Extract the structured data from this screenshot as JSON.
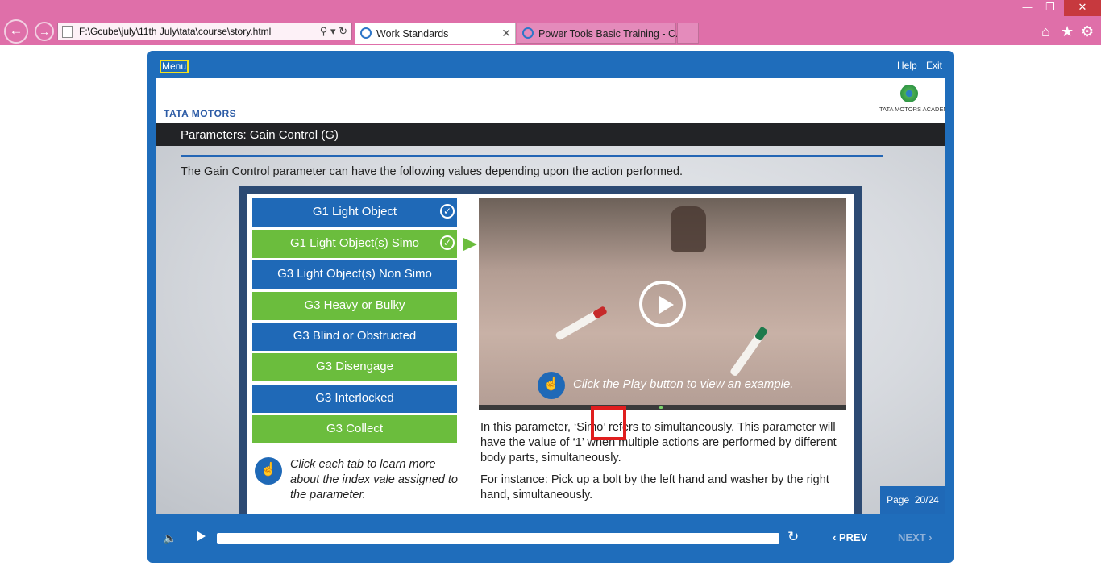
{
  "browser": {
    "address": "F:\\Gcube\\july\\11th July\\tata\\course\\story.html",
    "tabs": [
      {
        "label": "Work Standards",
        "active": true
      },
      {
        "label": "Power Tools Basic Training - C...",
        "active": false
      }
    ],
    "icons": [
      "back-icon",
      "forward-icon",
      "search-icon",
      "dropdown-icon",
      "refresh-icon",
      "home-icon",
      "favorites-icon",
      "settings-icon"
    ],
    "theme_color": "#df6fa9"
  },
  "player": {
    "menu_label": "Menu",
    "help_label": "Help",
    "exit_label": "Exit",
    "brand_logo_text": "TATA MOTORS",
    "academy_logo_text": "TATA MOTORS ACADEMY",
    "slide_title": "Parameters: Gain Control (G)",
    "intro_text": "The Gain Control parameter can have the following  values depending upon the action performed.",
    "tabs": [
      {
        "label": "G1 Light Object",
        "color": "blue",
        "checked": true
      },
      {
        "label": "G1 Light Object(s) Simo",
        "color": "green",
        "checked": true,
        "current": true
      },
      {
        "label": "G3 Light Object(s) Non Simo",
        "color": "blue",
        "checked": false
      },
      {
        "label": "G3 Heavy or Bulky",
        "color": "green",
        "checked": false
      },
      {
        "label": "G3 Blind or Obstructed",
        "color": "blue",
        "checked": false
      },
      {
        "label": "G3 Disengage",
        "color": "green",
        "checked": false
      },
      {
        "label": "G3 Interlocked",
        "color": "blue",
        "checked": false
      },
      {
        "label": "G3 Collect",
        "color": "green",
        "checked": false
      }
    ],
    "tab_hint": "Click each tab to learn more about the index vale assigned to the parameter.",
    "video_hint": "Click the Play button to view an example.",
    "para1": "In this parameter, ‘Simo’ refers to simultaneously. This parameter will have the value of ‘1’ when multiple actions are performed by different body parts, simultaneously.",
    "para2": "For instance: Pick up a bolt by the left hand and washer by the right hand, simultaneously.",
    "page_label": "Page",
    "page_value": "20/24",
    "prev_label": "PREV",
    "next_label": "NEXT",
    "colors": {
      "blue": "#1f69b7",
      "green": "#6bbd3d",
      "frame": "#1f6dbb",
      "highlight": "#e01e1e"
    }
  }
}
